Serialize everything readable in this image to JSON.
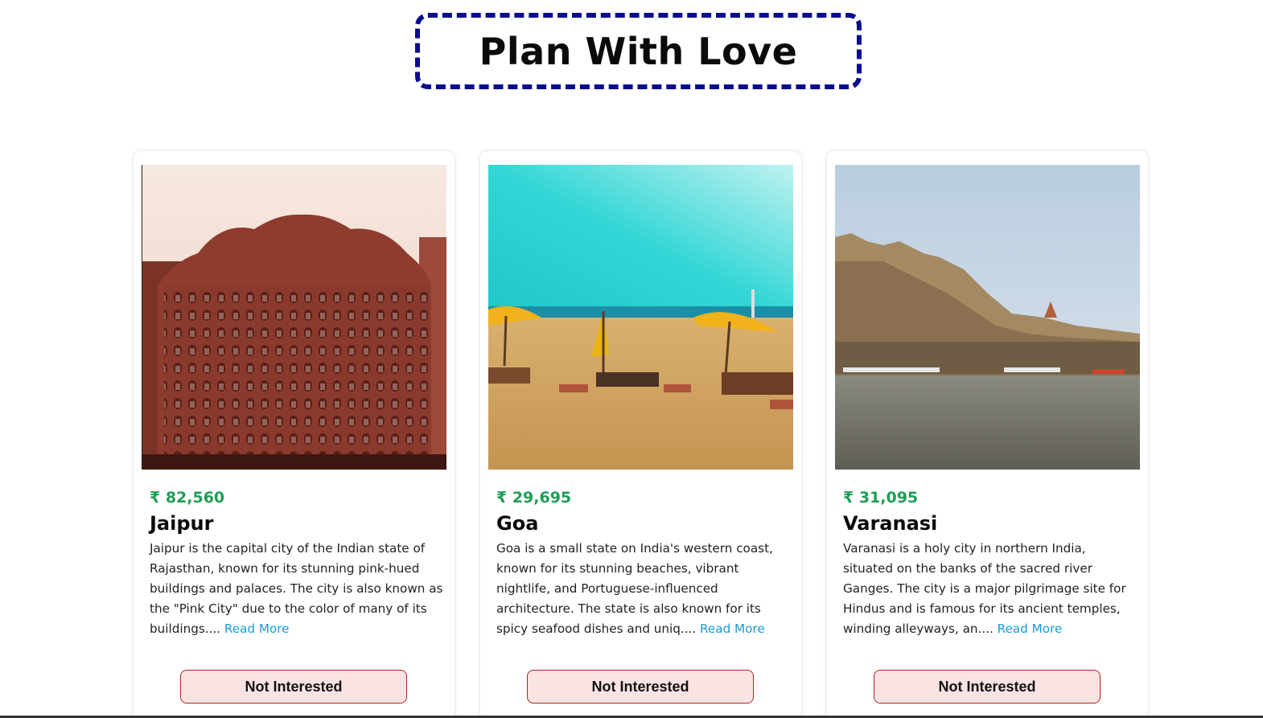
{
  "header": {
    "title": "Plan With Love"
  },
  "colors": {
    "title_border": "#0b0b8f",
    "price": "#1f9d55",
    "read_more": "#1a9bd7",
    "button_bg": "#fbe3e3",
    "button_border": "#b52525"
  },
  "tours": [
    {
      "price": "₹ 82,560",
      "name": "Jaipur",
      "description": "Jaipur is the capital city of the Indian state of Rajasthan, known for its stunning pink-hued buildings and palaces. The city is also known as the \"Pink City\" due to the color of many of its buildings....",
      "read_more": "Read More",
      "button": "Not Interested",
      "image_icon": "jaipur-palace-photo"
    },
    {
      "price": "₹ 29,695",
      "name": "Goa",
      "description": "Goa is a small state on India's western coast, known for its stunning beaches, vibrant nightlife, and Portuguese-influenced architecture. The state is also known for its spicy seafood dishes and uniq....",
      "read_more": "Read More",
      "button": "Not Interested",
      "image_icon": "goa-beach-photo"
    },
    {
      "price": "₹ 31,095",
      "name": "Varanasi",
      "description": "Varanasi is a holy city in northern India, situated on the banks of the sacred river Ganges. The city is a major pilgrimage site for Hindus and is famous for its ancient temples, winding alleyways, an....",
      "read_more": "Read More",
      "button": "Not Interested",
      "image_icon": "varanasi-ghats-photo"
    }
  ]
}
